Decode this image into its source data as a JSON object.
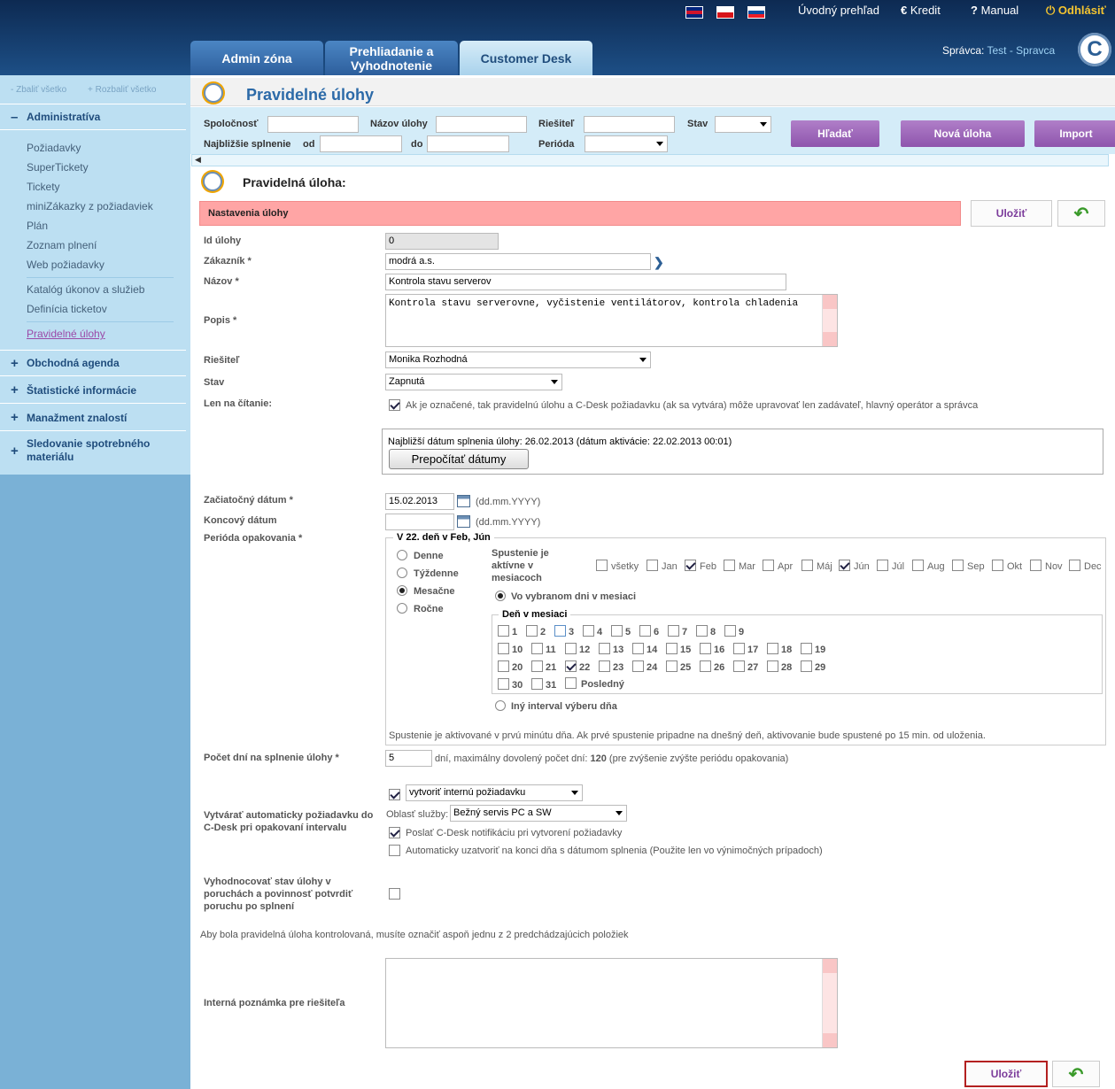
{
  "header": {
    "nav": [
      "Úvodný prehľad",
      "Kredit",
      "Manual",
      "Odhlásiť"
    ],
    "user_label": "Správca:",
    "user_name": "Test - Spravca",
    "logo_letter": "C",
    "tabs": [
      "Admin zóna",
      "Prehliadanie a Vyhodnotenie",
      "Customer Desk"
    ]
  },
  "sidebar": {
    "collapse_all": "- Zbaliť všetko",
    "expand_all": "+ Rozbaliť všetko",
    "section_admin": "Administratíva",
    "items": [
      "Požiadavky",
      "SuperTickety",
      "Tickety",
      "miniZákazky z požiadaviek",
      "Plán",
      "Zoznam plnení",
      "Web požiadavky",
      "Katalóg úkonov a služieb",
      "Definícia ticketov",
      "Pravidelné úlohy"
    ],
    "sections": [
      "Obchodná agenda",
      "Štatistické informácie",
      "Manažment znalostí",
      "Sledovanie spotrebného materiálu"
    ]
  },
  "page": {
    "title": "Pravidelné úlohy",
    "form_title": "Pravidelná úloha:",
    "section_header": "Nastavenia úlohy",
    "save": "Uložiť"
  },
  "filter": {
    "company": "Spoločnosť",
    "task_name": "Názov úlohy",
    "solver": "Riešiteľ",
    "state": "Stav",
    "nearest": "Najbližšie splnenie",
    "from": "od",
    "to": "do",
    "period": "Perióda",
    "search_btn": "Hľadať",
    "new_btn": "Nová úloha",
    "import_btn": "Import"
  },
  "form": {
    "id_label": "Id úlohy",
    "id_value": "0",
    "customer_label": "Zákazník *",
    "customer_value": "modrá a.s.",
    "name_label": "Názov *",
    "name_value": "Kontrola stavu serverov",
    "desc_label": "Popis *",
    "desc_value": "Kontrola stavu serverovne, vyčistenie ventilátorov, kontrola chladenia",
    "solver_label": "Riešiteľ",
    "solver_value": "Monika Rozhodná",
    "state_label": "Stav",
    "state_value": "Zapnutá",
    "readonly_label": "Len na čítanie:",
    "readonly_text": "Ak je označené, tak pravidelnú úlohu a C-Desk požiadavku (ak sa vytvára) môže upravovať len zadávateľ, hlavný operátor a správca",
    "nearest_info": "Najbližší dátum splnenia úlohy: 26.02.2013 (dátum aktivácie: 22.02.2013 00:01)",
    "recalc_btn": "Prepočítať dátumy",
    "start_label": "Začiatočný dátum *",
    "start_value": "15.02.2013",
    "date_hint": "(dd.mm.YYYY)",
    "end_label": "Koncový dátum",
    "period_label": "Perióda opakovania *",
    "period_summary": "V 22. deň v Feb, Jún",
    "period_options": [
      "Denne",
      "Týždenne",
      "Mesačne",
      "Ročne"
    ],
    "months_label": "Spustenie je aktívne v mesiacoch",
    "months": [
      "všetky",
      "Jan",
      "Feb",
      "Mar",
      "Apr",
      "Máj",
      "Jún",
      "Júl",
      "Aug",
      "Sep",
      "Okt",
      "Nov",
      "Dec"
    ],
    "selected_days_label": "Vo vybranom dni v mesiaci",
    "day_group_label": "Deň v mesiaci",
    "last_day": "Posledný",
    "other_interval": "Iný interval výberu dňa",
    "activation_note": "Spustenie je aktivované v prvú minútu dňa. Ak prvé spustenie pripadne na dnešný deň, aktivovanie bude spustené po 15 min. od uloženia.",
    "days_label": "Počet dní na splnenie úlohy *",
    "days_value": "5",
    "days_text_a": "dní, maximálny dovolený počet dní:",
    "days_max": "120",
    "days_text_b": "(pre zvýšenie zvýšte periódu opakovania)",
    "auto_label": "Vytvárať automaticky požiadavku do C-Desk pri opakovaní intervalu",
    "auto_select": "vytvoriť internú požiadavku",
    "service_label": "Oblasť služby:",
    "service_value": "Bežný servis PC a SW",
    "notify_text": "Poslať C-Desk notifikáciu pri vytvorení požiadavky",
    "autoclose_text": "Automaticky uzatvoriť na konci dňa s dátumom splnenia (Použite len vo výnimočných prípadoch)",
    "evaluate_label": "Vyhodnocovať stav úlohy v poruchách a povinnosť potvrdiť poruchu po splnení",
    "control_note": "Aby bola pravidelná úloha kontrolovaná, musíte označiť aspoň jednu z 2 predchádzajúcich položiek",
    "note_label": "Interná poznámka pre riešiteľa"
  }
}
